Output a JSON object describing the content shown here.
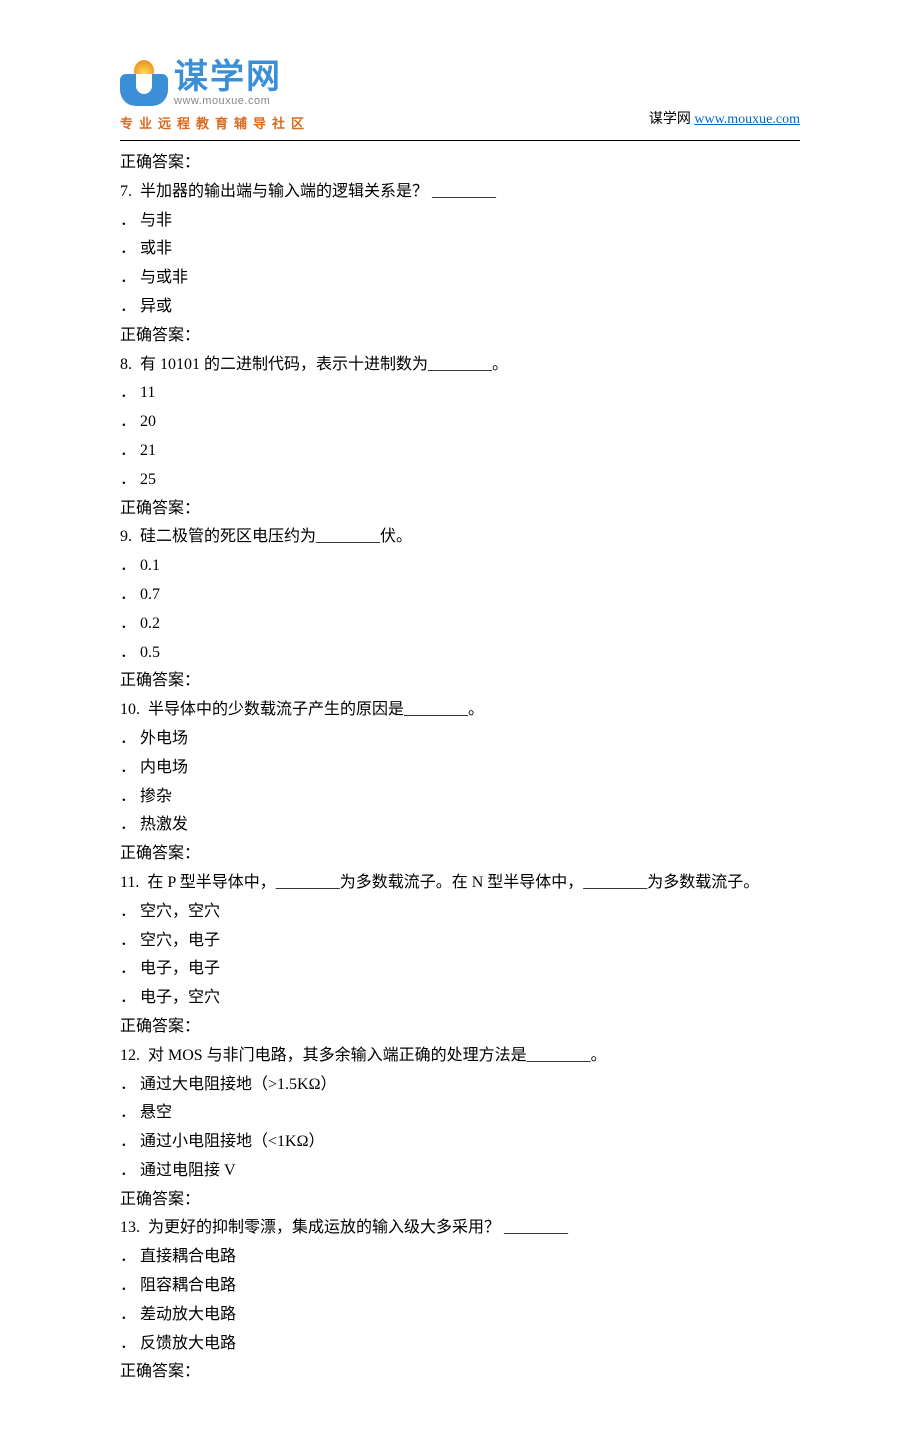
{
  "header": {
    "logo_cn": "谋学网",
    "logo_url": "www.mouxue.com",
    "tagline": "专业远程教育辅导社区",
    "right_label": "谋学网",
    "right_link": "www.mouxue.com"
  },
  "answer_label": "正确答案：",
  "questions": [
    {
      "num": "7.",
      "text": "半加器的输出端与输入端的逻辑关系是？ ________",
      "options": [
        "． 与非",
        "． 或非",
        "． 与或非",
        "． 异或"
      ]
    },
    {
      "num": "8.",
      "text": "有 10101 的二进制代码，表示十进制数为________。",
      "options": [
        "． 11",
        "． 20",
        "． 21",
        "． 25"
      ]
    },
    {
      "num": "9.",
      "text": "硅二极管的死区电压约为________伏。",
      "options": [
        "． 0.1",
        "． 0.7",
        "． 0.2",
        "． 0.5"
      ]
    },
    {
      "num": "10.",
      "text": "半导体中的少数载流子产生的原因是________。",
      "options": [
        "． 外电场",
        "． 内电场",
        "． 掺杂",
        "． 热激发"
      ]
    },
    {
      "num": "11.",
      "text": "在 P 型半导体中，________为多数载流子。在 N 型半导体中，________为多数载流子。",
      "options": [
        "． 空穴，空穴",
        "． 空穴，电子",
        "． 电子，电子",
        "． 电子，空穴"
      ]
    },
    {
      "num": "12.",
      "text": "对 MOS 与非门电路，其多余输入端正确的处理方法是________。",
      "options": [
        "． 通过大电阻接地（>1.5KΩ）",
        "． 悬空",
        "． 通过小电阻接地（<1KΩ）",
        "． 通过电阻接 V"
      ]
    },
    {
      "num": "13.",
      "text": "为更好的抑制零漂，集成运放的输入级大多采用？ ________",
      "options": [
        "． 直接耦合电路",
        "． 阻容耦合电路",
        "． 差动放大电路",
        "． 反馈放大电路"
      ]
    }
  ]
}
